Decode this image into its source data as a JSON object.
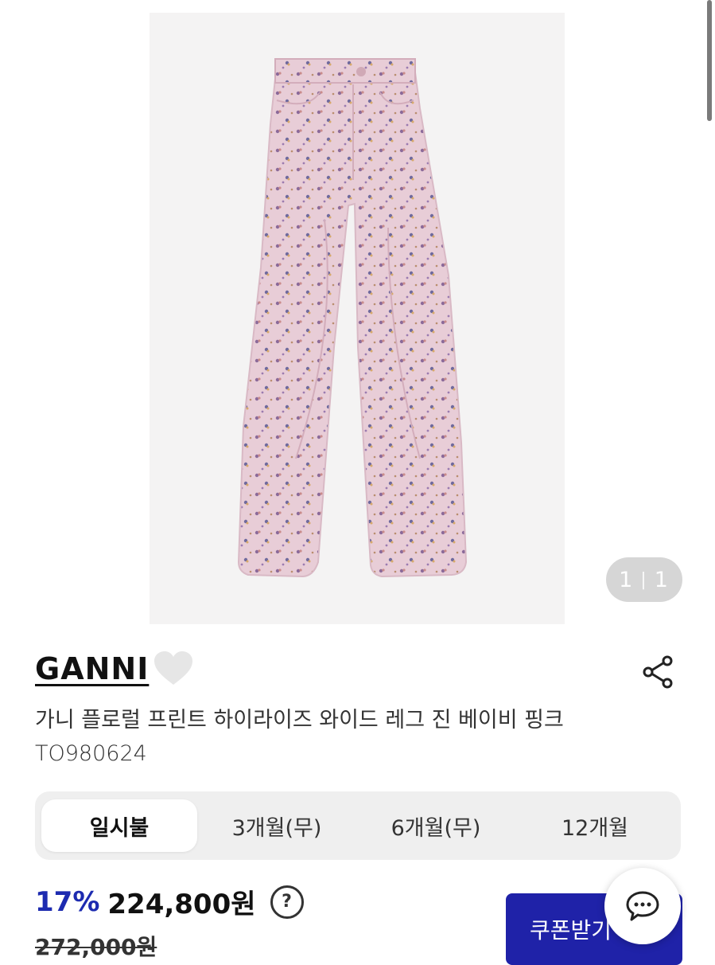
{
  "gallery": {
    "image_alt": "GANNI floral print high-rise wide leg jeans baby pink",
    "counter_current": "1",
    "counter_separator": "|",
    "counter_total": "1"
  },
  "product": {
    "brand": "GANNI",
    "title": "가니 플로럴 프린트 하이라이즈 와이드 레그 진 베이비 핑크",
    "code": "TO980624"
  },
  "payment_tabs": [
    {
      "label": "일시불",
      "active": true
    },
    {
      "label": "3개월(무)",
      "active": false
    },
    {
      "label": "6개월(무)",
      "active": false
    },
    {
      "label": "12개월",
      "active": false
    }
  ],
  "pricing": {
    "discount": "17%",
    "price": "224,800원",
    "help_symbol": "?",
    "original_price": "272,000원"
  },
  "actions": {
    "coupon_label": "쿠폰받기",
    "wishlist_icon": "heart-icon",
    "share_icon": "share-icon",
    "chat_icon": "chat-bubble-icon"
  },
  "colors": {
    "accent": "#1d2bb0",
    "coupon_bg": "#1f22a8",
    "tab_bg": "#efefef",
    "counter_bg": "#d6d6d6"
  }
}
